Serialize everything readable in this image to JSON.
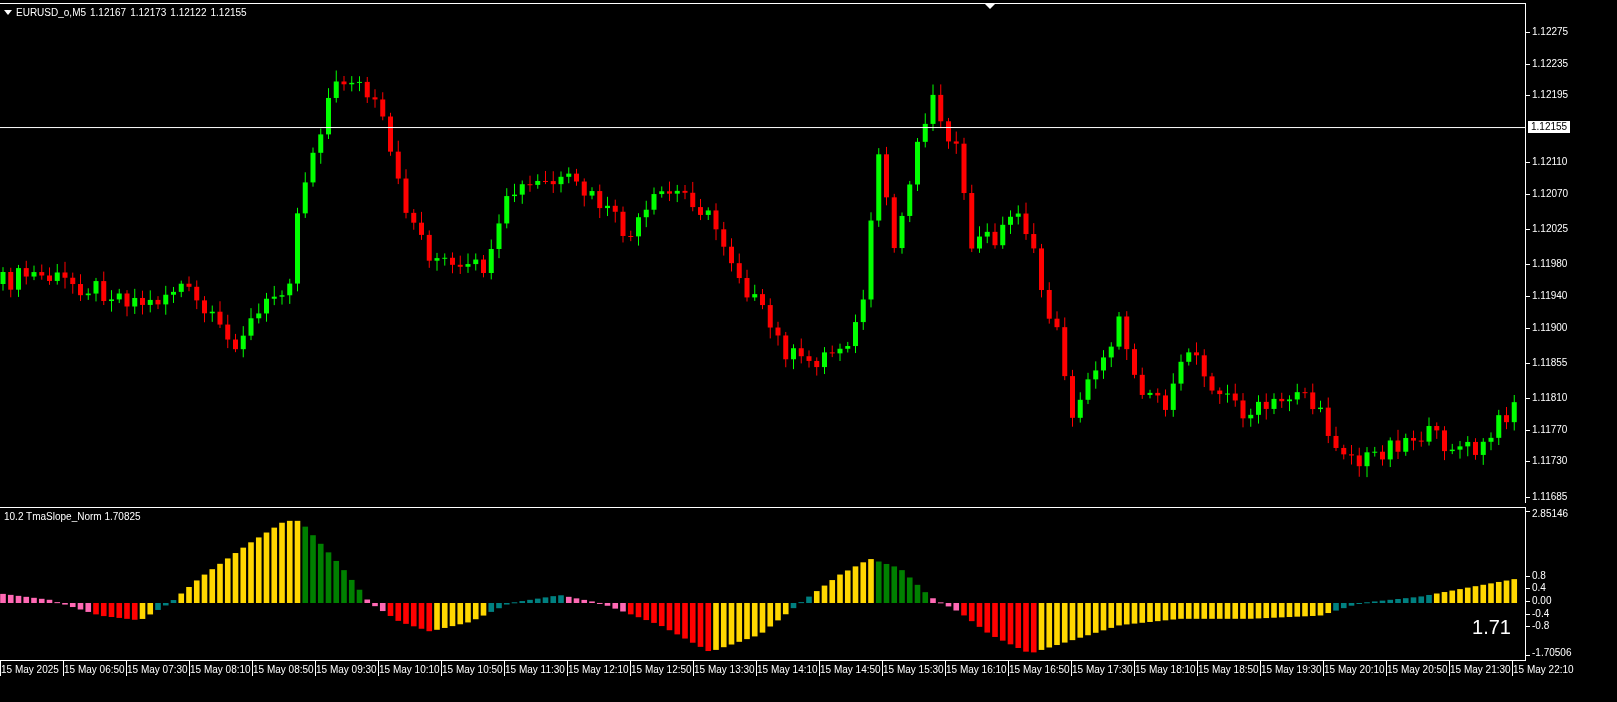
{
  "chart_header": {
    "symbol": "EURUSD_o,M5",
    "quotes": [
      "1.12167",
      "1.12173",
      "1.12122",
      "1.12155"
    ]
  },
  "price_axis": {
    "ticks": [
      "1.12275",
      "1.12235",
      "1.12195",
      "1.12110",
      "1.12070",
      "1.12025",
      "1.11980",
      "1.11940",
      "1.11900",
      "1.11855",
      "1.11810",
      "1.11770",
      "1.11730",
      "1.11685"
    ],
    "current_price": "1.12155"
  },
  "indicator": {
    "title": "10.2 TmaSlope_Norm 1.70825",
    "axis_ticks": [
      "2.85146",
      "0.8",
      "0.4",
      "0.00",
      "-0.4",
      "-0.8",
      "-1.70506"
    ],
    "value_label": "1.71"
  },
  "time_axis": {
    "labels": [
      "15 May 2025",
      "15 May 06:50",
      "15 May 07:30",
      "15 May 08:10",
      "15 May 08:50",
      "15 May 09:30",
      "15 May 10:10",
      "15 May 10:50",
      "15 May 11:30",
      "15 May 12:10",
      "15 May 12:50",
      "15 May 13:30",
      "15 May 14:10",
      "15 May 14:50",
      "15 May 15:30",
      "15 May 16:10",
      "15 May 16:50",
      "15 May 17:30",
      "15 May 18:10",
      "15 May 18:50",
      "15 May 19:30",
      "15 May 20:10",
      "15 May 20:50",
      "15 May 21:30",
      "15 May 22:10"
    ]
  }
}
